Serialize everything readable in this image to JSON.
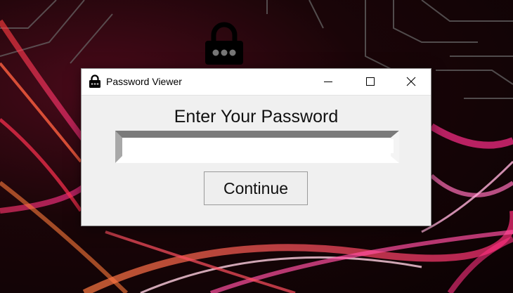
{
  "window": {
    "title": "Password Viewer",
    "icon": "lock-icon",
    "controls": {
      "minimize": "minimize-icon",
      "maximize": "maximize-icon",
      "close": "close-icon"
    }
  },
  "form": {
    "heading": "Enter Your Password",
    "password_value": "",
    "continue_label": "Continue"
  },
  "colors": {
    "window_bg": "#f0f0f0",
    "titlebar_bg": "#ffffff",
    "wallpaper_accent": "#ff2d6a"
  }
}
